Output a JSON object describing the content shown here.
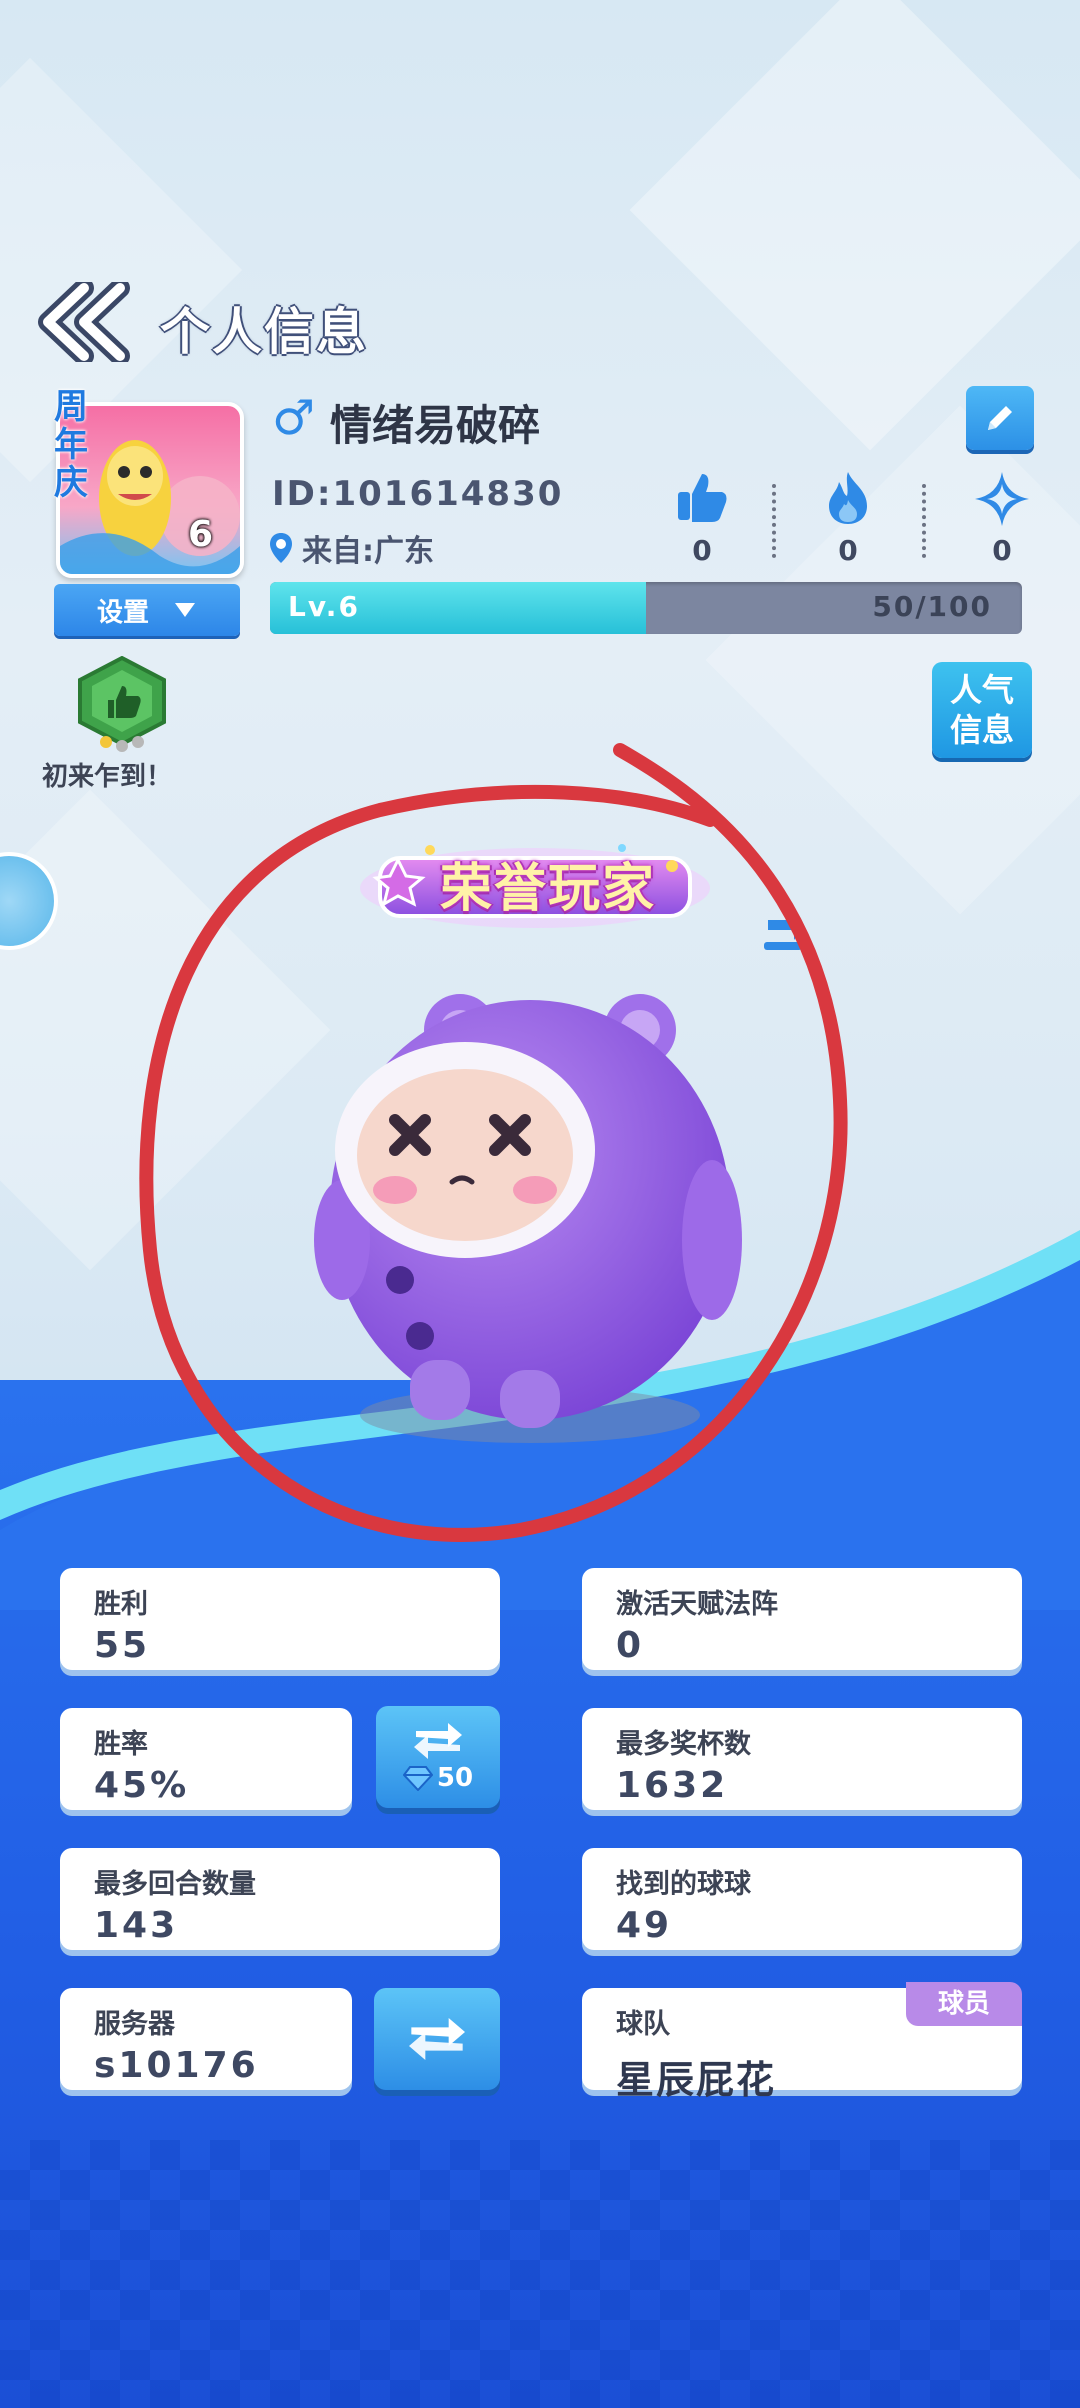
{
  "header": {
    "title": "个人信息"
  },
  "profile": {
    "avatar_banner": "周年庆",
    "avatar_level": "6",
    "settings_label": "设置",
    "gender_symbol": "♂",
    "nickname": "情绪易破碎",
    "id_text": "ID:101614830",
    "location": "来自:广东",
    "stats": [
      {
        "icon": "thumbs-up-icon",
        "count": "0"
      },
      {
        "icon": "fire-icon",
        "count": "0"
      },
      {
        "icon": "star-icon",
        "count": "0"
      }
    ],
    "level": {
      "label": "Lv.6",
      "exp_text": "50/100",
      "progress": 0.5
    },
    "badge_label": "初来乍到！",
    "popularity_button": [
      "人气",
      "信息"
    ]
  },
  "honor_title": "荣誉玩家",
  "stats_cards": {
    "wins": {
      "label": "胜利",
      "value": "55"
    },
    "talent": {
      "label": "激活天赋法阵",
      "value": "0"
    },
    "win_rate": {
      "label": "胜率",
      "value": "45%",
      "refresh_cost": "50"
    },
    "max_trophies": {
      "label": "最多奖杯数",
      "value": "1632"
    },
    "max_rounds": {
      "label": "最多回合数量",
      "value": "143"
    },
    "balls_found": {
      "label": "找到的球球",
      "value": "49"
    },
    "server": {
      "label": "服务器",
      "value": "s10176"
    },
    "team": {
      "label": "球队",
      "value": "星辰屁花",
      "role": "球员"
    }
  },
  "colors": {
    "accent_blue": "#2d8ee6",
    "level_fill": "#27c0d8",
    "annotation_red": "#d9383f",
    "role_badge": "#b88ae8"
  }
}
